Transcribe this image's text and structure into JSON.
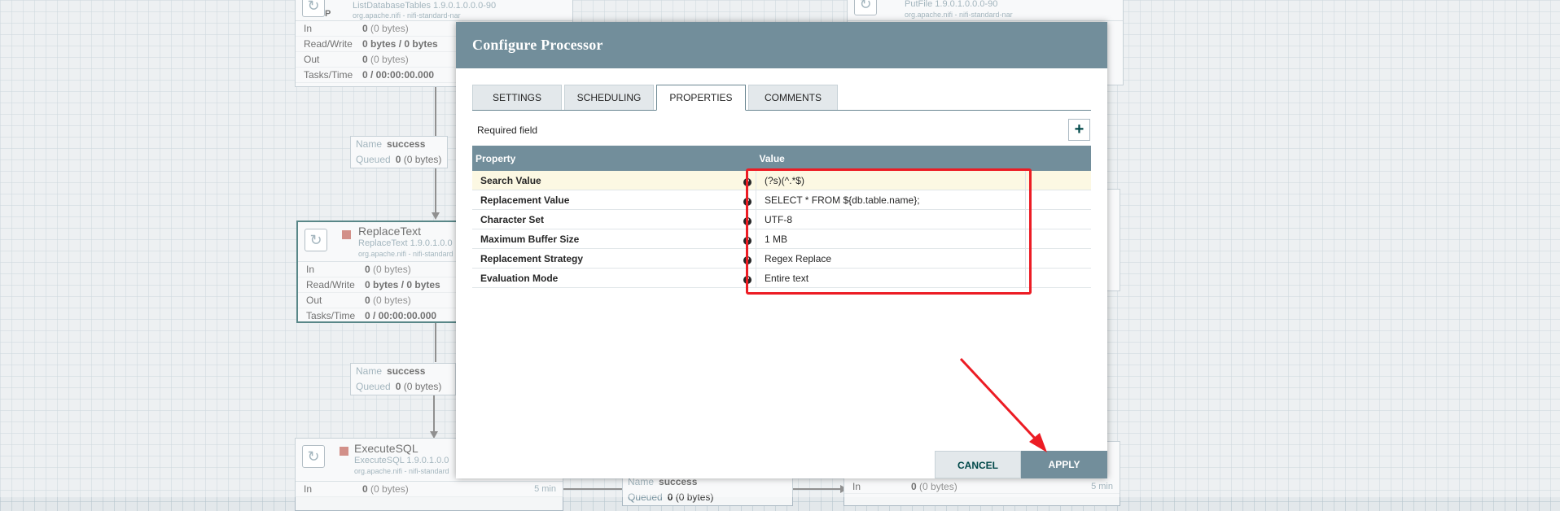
{
  "canvas": {
    "processors": {
      "list_db": {
        "name": "ListDatabaseTables",
        "type": "ListDatabaseTables 1.9.0.1.0.0.0-90",
        "bundle": "org.apache.nifi - nifi-standard-nar",
        "badge": "P",
        "rows": [
          {
            "k": "In",
            "v": "0",
            "extra": "(0 bytes)",
            "r": ""
          },
          {
            "k": "Read/Write",
            "v": "0 bytes / 0 bytes",
            "extra": "",
            "r": ""
          },
          {
            "k": "Out",
            "v": "0",
            "extra": "(0 bytes)",
            "r": ""
          },
          {
            "k": "Tasks/Time",
            "v": "0 / 00:00:00.000",
            "extra": "",
            "r": ""
          }
        ]
      },
      "putfile": {
        "name": "PutFile",
        "type": "PutFile 1.9.0.1.0.0.0-90",
        "bundle": "org.apache.nifi - nifi-standard-nar"
      },
      "replace": {
        "name": "ReplaceText",
        "type": "ReplaceText 1.9.0.1.0.0",
        "bundle": "org.apache.nifi - nifi-standard",
        "rows": [
          {
            "k": "In",
            "v": "0",
            "extra": "(0 bytes)",
            "r": ""
          },
          {
            "k": "Read/Write",
            "v": "0 bytes / 0 bytes",
            "extra": "",
            "r": ""
          },
          {
            "k": "Out",
            "v": "0",
            "extra": "(0 bytes)",
            "r": ""
          },
          {
            "k": "Tasks/Time",
            "v": "0 / 00:00:00.000",
            "extra": "",
            "r": ""
          }
        ]
      },
      "execsql": {
        "name": "ExecuteSQL",
        "type": "ExecuteSQL 1.9.0.1.0.0",
        "bundle": "org.apache.nifi - nifi-standard",
        "rows": [
          {
            "k": "In",
            "v": "0",
            "extra": "(0 bytes)",
            "r": "5 min"
          }
        ]
      },
      "bottom_right": {
        "rows": [
          {
            "k": "In",
            "v": "0",
            "extra": "(0 bytes)",
            "r": "5 min"
          }
        ]
      }
    },
    "connections": [
      {
        "name_label": "Name",
        "name": "success",
        "queued_label": "Queued",
        "queued": "0",
        "queued_extra": "(0 bytes)"
      },
      {
        "name_label": "Name",
        "name": "success",
        "queued_label": "Queued",
        "queued": "0",
        "queued_extra": "(0 bytes)"
      },
      {
        "name_label": "Name",
        "name": "success",
        "queued_label": "Queued",
        "queued": "0",
        "queued_extra": "(0 bytes)"
      }
    ]
  },
  "dialog": {
    "title": "Configure Processor",
    "tabs": [
      "SETTINGS",
      "SCHEDULING",
      "PROPERTIES",
      "COMMENTS"
    ],
    "active_tab": "PROPERTIES",
    "required_field": "Required field",
    "add_label": "+",
    "table": {
      "headers": {
        "property": "Property",
        "value": "Value"
      },
      "rows": [
        {
          "name": "Search Value",
          "value": "(?s)(^.*$)"
        },
        {
          "name": "Replacement Value",
          "value": "SELECT * FROM ${db.table.name};"
        },
        {
          "name": "Character Set",
          "value": "UTF-8"
        },
        {
          "name": "Maximum Buffer Size",
          "value": "1 MB"
        },
        {
          "name": "Replacement Strategy",
          "value": "Regex Replace"
        },
        {
          "name": "Evaluation Mode",
          "value": "Entire text"
        }
      ]
    },
    "help_glyph": "?",
    "buttons": {
      "cancel": "CANCEL",
      "apply": "APPLY"
    }
  },
  "icons": {
    "processor": "refresh-icon",
    "help": "question-circle-icon",
    "add": "plus-icon"
  },
  "colors": {
    "header": "#728e9b",
    "highlight_row": "#fcf8e3",
    "annotation": "#ec1c24",
    "stopped": "#ba554a"
  }
}
